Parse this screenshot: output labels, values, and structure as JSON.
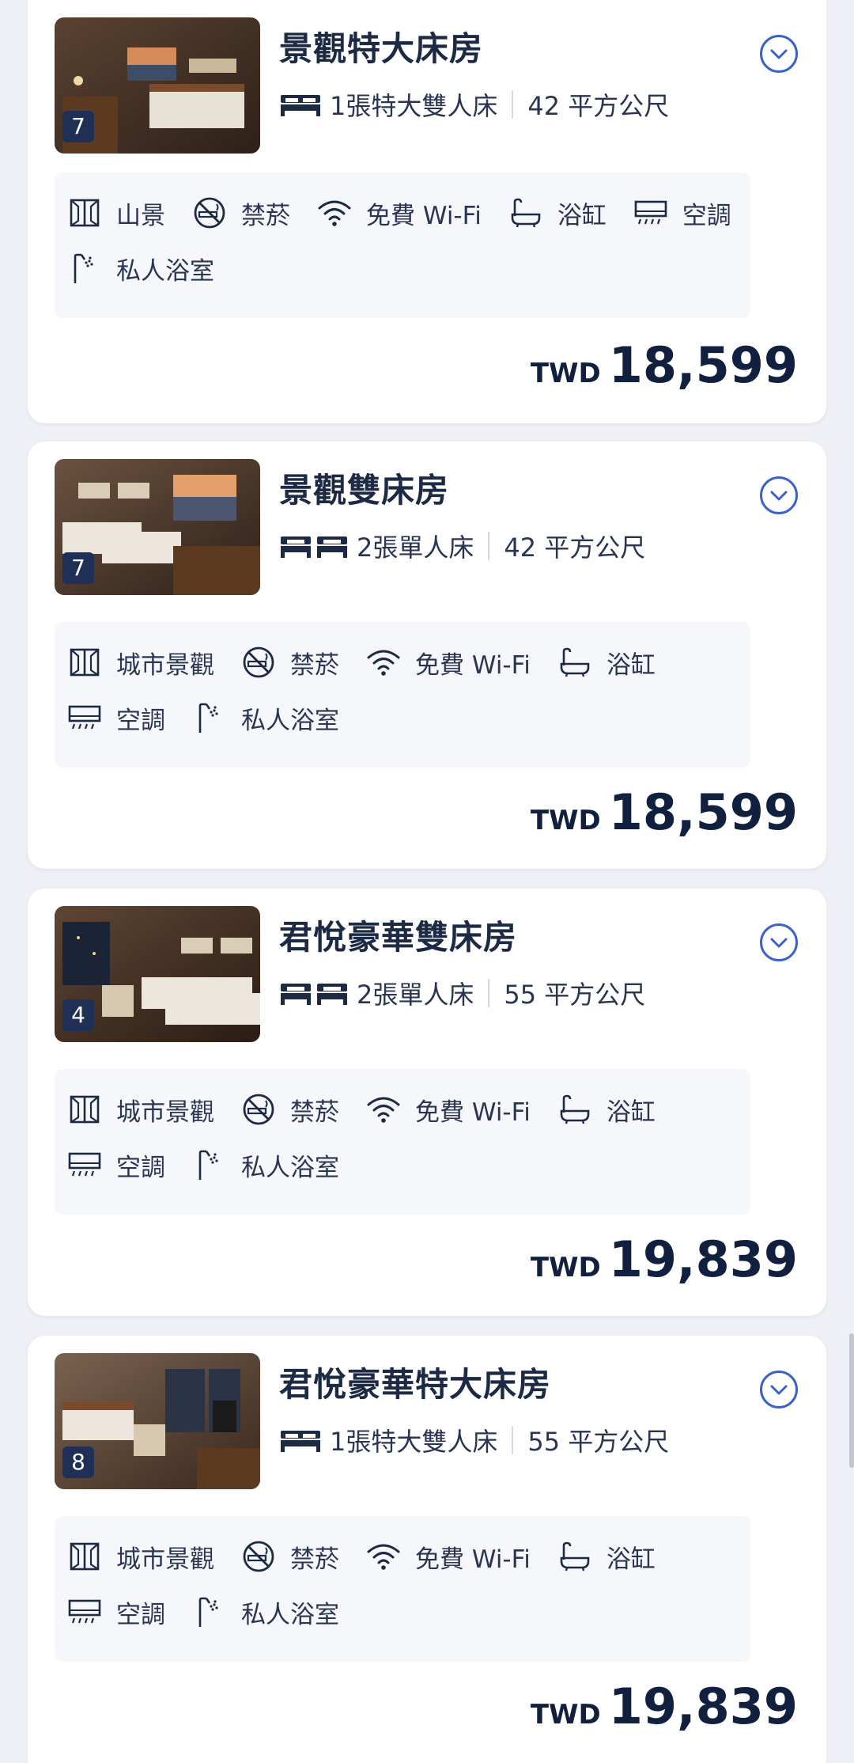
{
  "rooms": [
    {
      "title": "景觀特大床房",
      "photo_count": "7",
      "bed_type": "1張特大雙人床",
      "bed_icon": "king-bed-icon",
      "size": "42 平方公尺",
      "amenities": [
        "山景",
        "禁菸",
        "免費 Wi-Fi",
        "浴缸",
        "空調",
        "私人浴室"
      ],
      "currency": "TWD",
      "price": "18,599"
    },
    {
      "title": "景觀雙床房",
      "photo_count": "7",
      "bed_type": "2張單人床",
      "bed_icon": "twin-bed-icon",
      "size": "42 平方公尺",
      "amenities": [
        "城市景觀",
        "禁菸",
        "免費 Wi-Fi",
        "浴缸",
        "空調",
        "私人浴室"
      ],
      "currency": "TWD",
      "price": "18,599"
    },
    {
      "title": "君悅豪華雙床房",
      "photo_count": "4",
      "bed_type": "2張單人床",
      "bed_icon": "twin-bed-icon",
      "size": "55 平方公尺",
      "amenities": [
        "城市景觀",
        "禁菸",
        "免費 Wi-Fi",
        "浴缸",
        "空調",
        "私人浴室"
      ],
      "currency": "TWD",
      "price": "19,839"
    },
    {
      "title": "君悅豪華特大床房",
      "photo_count": "8",
      "bed_type": "1張特大雙人床",
      "bed_icon": "king-bed-icon",
      "size": "55 平方公尺",
      "amenities": [
        "城市景觀",
        "禁菸",
        "免費 Wi-Fi",
        "浴缸",
        "空調",
        "私人浴室"
      ],
      "currency": "TWD",
      "price": "19,839"
    }
  ],
  "colors": {
    "accent": "#3a62c8",
    "title": "#1d2a44",
    "background": "#eef0f5",
    "card": "#ffffff",
    "amenity_panel": "#f6f7fb",
    "badge": "#1f2f55"
  }
}
